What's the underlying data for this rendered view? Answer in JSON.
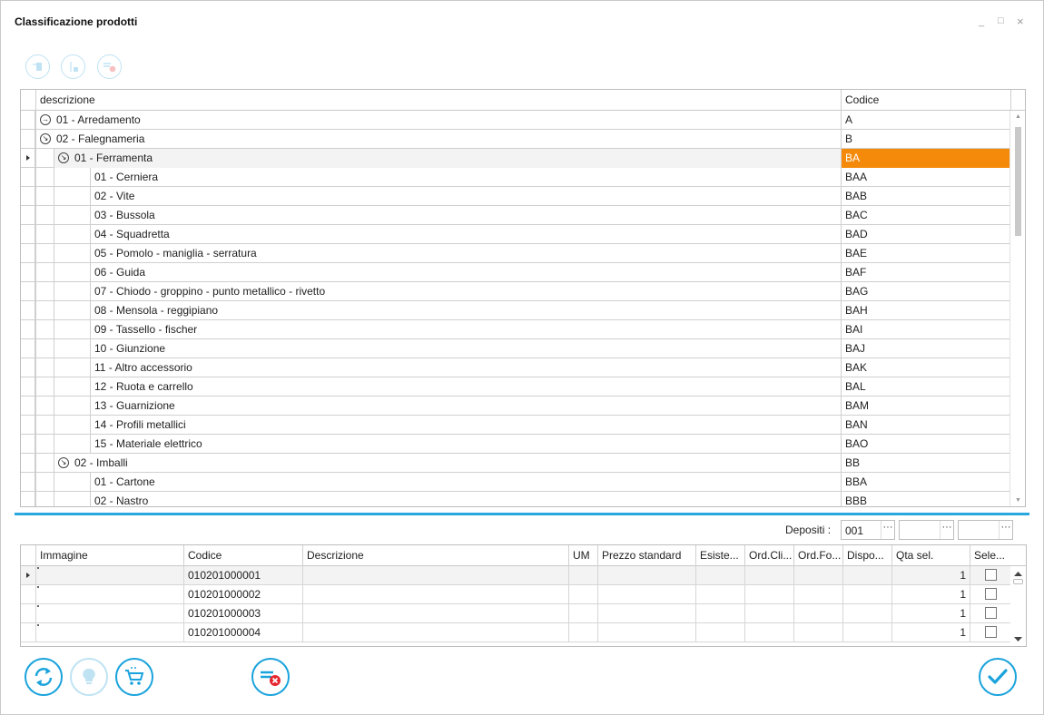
{
  "window": {
    "title": "Classificazione prodotti",
    "minimize": "_",
    "maximize": "□",
    "close": "×"
  },
  "tree": {
    "headers": {
      "description": "descrizione",
      "code": "Codice"
    },
    "rows": [
      {
        "desc": "01 - Arredamento",
        "code": "A",
        "level": 0,
        "expander": "collapsed"
      },
      {
        "desc": "02 - Falegnameria",
        "code": "B",
        "level": 0,
        "expander": "expanded"
      },
      {
        "desc": "01 - Ferramenta",
        "code": "BA",
        "level": 1,
        "expander": "expanded",
        "current": true
      },
      {
        "desc": "01 - Cerniera",
        "code": "BAA",
        "level": 2
      },
      {
        "desc": "02 - Vite",
        "code": "BAB",
        "level": 2
      },
      {
        "desc": "03 - Bussola",
        "code": "BAC",
        "level": 2
      },
      {
        "desc": "04 - Squadretta",
        "code": "BAD",
        "level": 2
      },
      {
        "desc": "05 - Pomolo - maniglia - serratura",
        "code": "BAE",
        "level": 2
      },
      {
        "desc": "06 - Guida",
        "code": "BAF",
        "level": 2
      },
      {
        "desc": "07 - Chiodo - groppino - punto metallico - rivetto",
        "code": "BAG",
        "level": 2
      },
      {
        "desc": "08 - Mensola - reggipiano",
        "code": "BAH",
        "level": 2
      },
      {
        "desc": "09 - Tassello - fischer",
        "code": "BAI",
        "level": 2
      },
      {
        "desc": "10 - Giunzione",
        "code": "BAJ",
        "level": 2
      },
      {
        "desc": "11 - Altro accessorio",
        "code": "BAK",
        "level": 2
      },
      {
        "desc": "12 - Ruota e carrello",
        "code": "BAL",
        "level": 2
      },
      {
        "desc": "13 - Guarnizione",
        "code": "BAM",
        "level": 2
      },
      {
        "desc": "14 - Profili metallici",
        "code": "BAN",
        "level": 2
      },
      {
        "desc": "15 - Materiale elettrico",
        "code": "BAO",
        "level": 2
      },
      {
        "desc": "02 - Imballi",
        "code": "BB",
        "level": 1,
        "expander": "expanded"
      },
      {
        "desc": "01 - Cartone",
        "code": "BBA",
        "level": 2
      },
      {
        "desc": "02 - Nastro",
        "code": "BBB",
        "level": 2
      }
    ]
  },
  "depositi": {
    "label": "Depositi :",
    "values": [
      "001",
      "",
      ""
    ],
    "dots": "···"
  },
  "grid": {
    "headers": [
      "Immagine",
      "Codice",
      "Descrizione",
      "UM",
      "Prezzo standard",
      "Esiste...",
      "Ord.Cli...",
      "Ord.Fo...",
      "Dispo...",
      "Qta sel.",
      "Sele..."
    ],
    "rows": [
      {
        "codice": "010201000001",
        "qta": "1"
      },
      {
        "codice": "010201000002",
        "qta": "1"
      },
      {
        "codice": "010201000003",
        "qta": "1"
      },
      {
        "codice": "010201000004",
        "qta": "1"
      }
    ]
  },
  "colors": {
    "accent": "#1aa3dc",
    "selection": "#f58a0a"
  }
}
